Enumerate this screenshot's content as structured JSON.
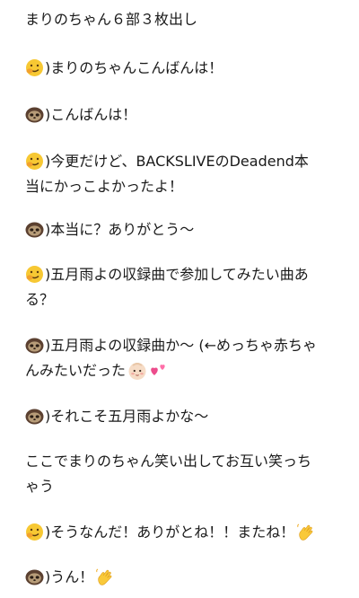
{
  "note": {
    "title": "まりのちゃん６部３枚出し",
    "lines": [
      {
        "speaker": "smile-face",
        "text": "まりのちゃんこんばんは！"
      },
      {
        "speaker": "sloth",
        "text": "こんばんは！"
      },
      {
        "speaker": "smile-face",
        "text": "今更だけど、BACKSLIVEのDeadend本"
      },
      {
        "speaker": "",
        "text": "当にかっこよかったよ！"
      },
      {
        "speaker": "sloth",
        "text": "本当に？ありがとう〜"
      },
      {
        "speaker": "smile-face",
        "text": "五月雨よの収録曲で参加してみたい曲あ"
      },
      {
        "speaker": "",
        "text": "る？"
      },
      {
        "speaker": "sloth",
        "text": "五月雨よの収録曲か〜 (←めっちゃ赤ちゃ"
      },
      {
        "speaker": "",
        "text": "んみたいだった",
        "trailing": [
          "baby-face",
          "two-hearts"
        ]
      },
      {
        "speaker": "sloth",
        "text": "それこそ五月雨よかな〜"
      },
      {
        "speaker": "",
        "text": "ここでまりのちゃん笑い出してお互い笑っち"
      },
      {
        "speaker": "",
        "text": "ゃう"
      },
      {
        "speaker": "smile-face",
        "text": "そうなんだ！ありがとね！！またね！",
        "trailing": [
          "waving-hand"
        ]
      },
      {
        "speaker": "sloth",
        "text": "うん！",
        "trailing": [
          "waving-hand"
        ]
      }
    ],
    "close_paren": ")"
  }
}
